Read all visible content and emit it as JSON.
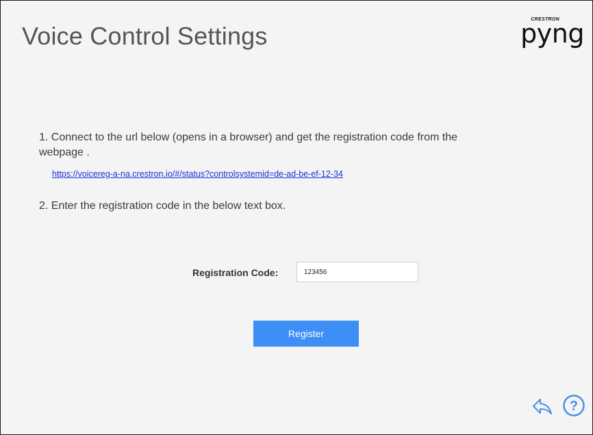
{
  "header": {
    "title": "Voice Control Settings",
    "brand_small": "CRESTRON",
    "brand_main": "pyng"
  },
  "instructions": {
    "step1": "1. Connect to the url below (opens in a browser) and get the registration code from the webpage .",
    "link": "https://voicereg-a-na.crestron.io/#/status?controlsystemid=de-ad-be-ef-12-34",
    "step2": "2. Enter the registration code in the below text box."
  },
  "form": {
    "label": "Registration Code:",
    "value": "123456",
    "button_label": "Register"
  },
  "icons": {
    "back": "back-arrow-icon",
    "help": "help-icon"
  },
  "colors": {
    "accent": "#3d8ef5",
    "link": "#1a2fd6",
    "icon": "#4a8fe8"
  }
}
